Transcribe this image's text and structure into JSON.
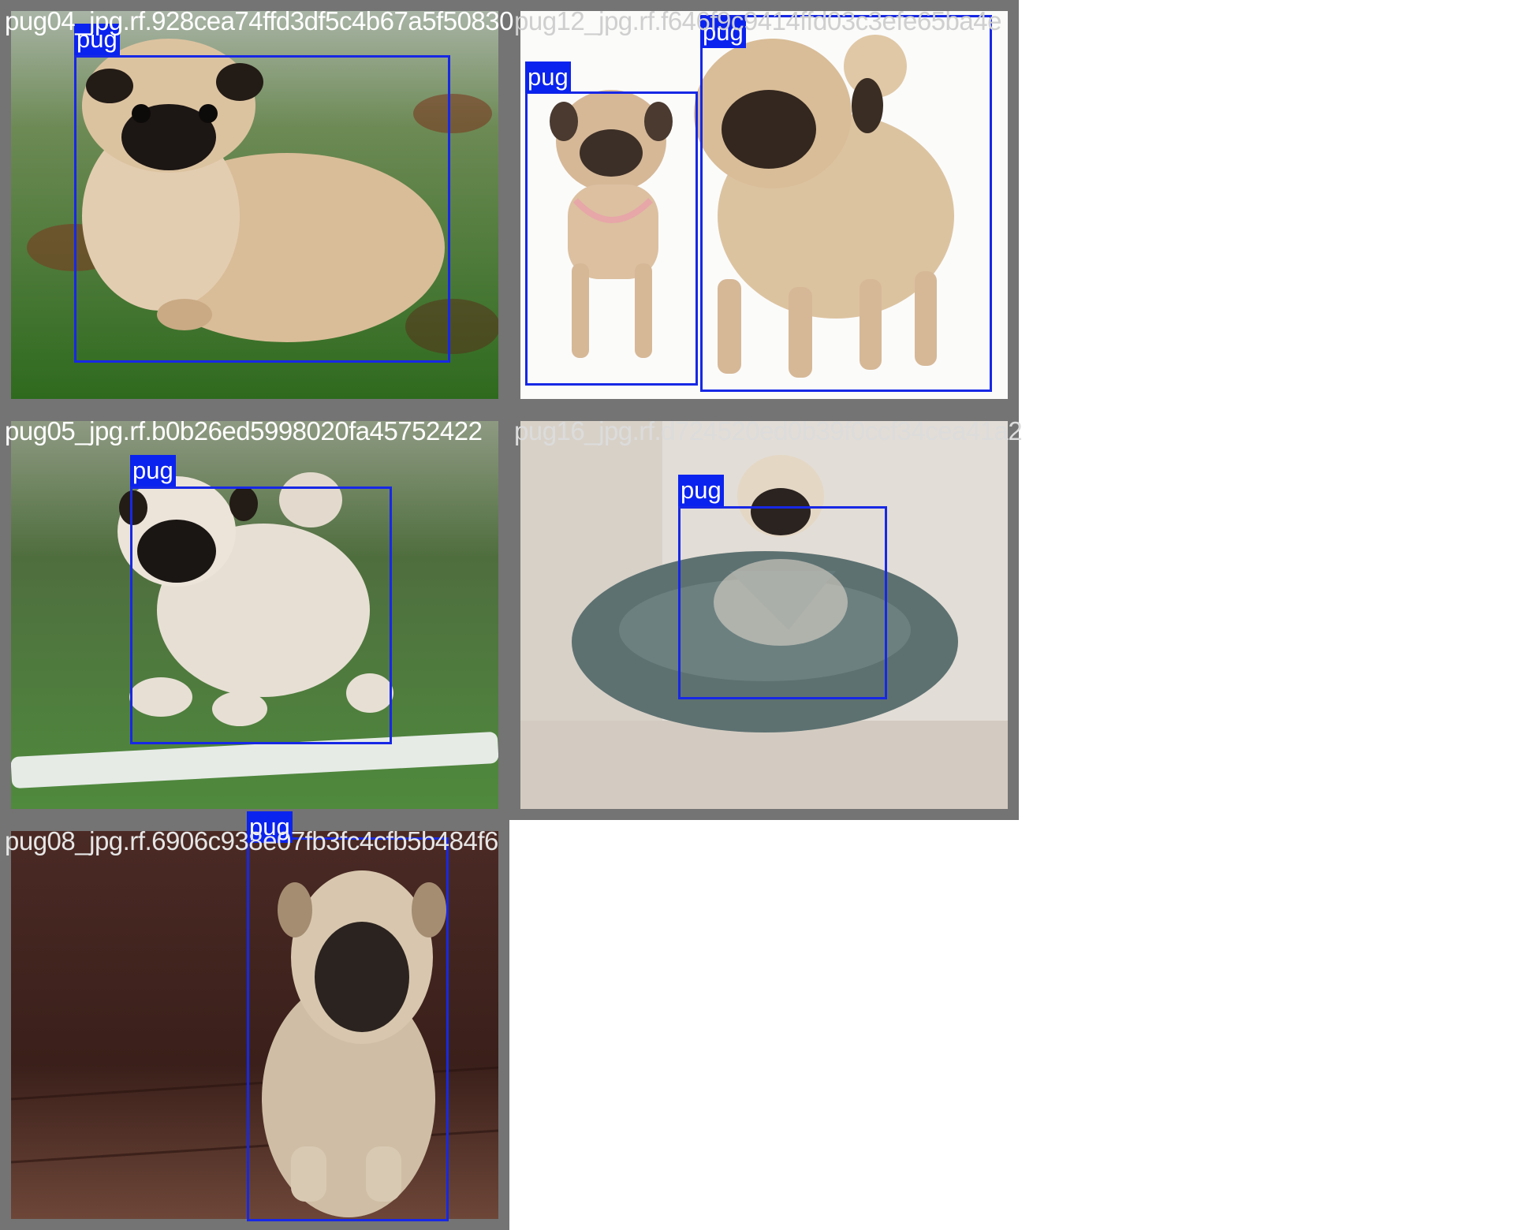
{
  "tiles": [
    {
      "filename": "pug04_jpg.rf.928cea74ffd3df5c4b67a5f50830",
      "detections": [
        {
          "label": "pug"
        }
      ]
    },
    {
      "filename": "pug12_jpg.rf.f646f9c9414ffd03c3efe65ba4e",
      "detections": [
        {
          "label": "pug"
        },
        {
          "label": "pug"
        }
      ]
    },
    {
      "filename": "pug05_jpg.rf.b0b26ed5998020fa45752422",
      "detections": [
        {
          "label": "pug"
        }
      ]
    },
    {
      "filename": "pug16_jpg.rf.d724520ed0b39f0ccf34cea41a2",
      "detections": [
        {
          "label": "pug"
        }
      ]
    },
    {
      "filename": "pug08_jpg.rf.6906c938e07fb3fc4cfb5b484f6",
      "detections": [
        {
          "label": "pug"
        }
      ]
    }
  ],
  "colors": {
    "tile_border": "#747474",
    "box_stroke": "#1728e5",
    "tag_fill": "#0b23ee",
    "label_text": "#ffffff"
  }
}
